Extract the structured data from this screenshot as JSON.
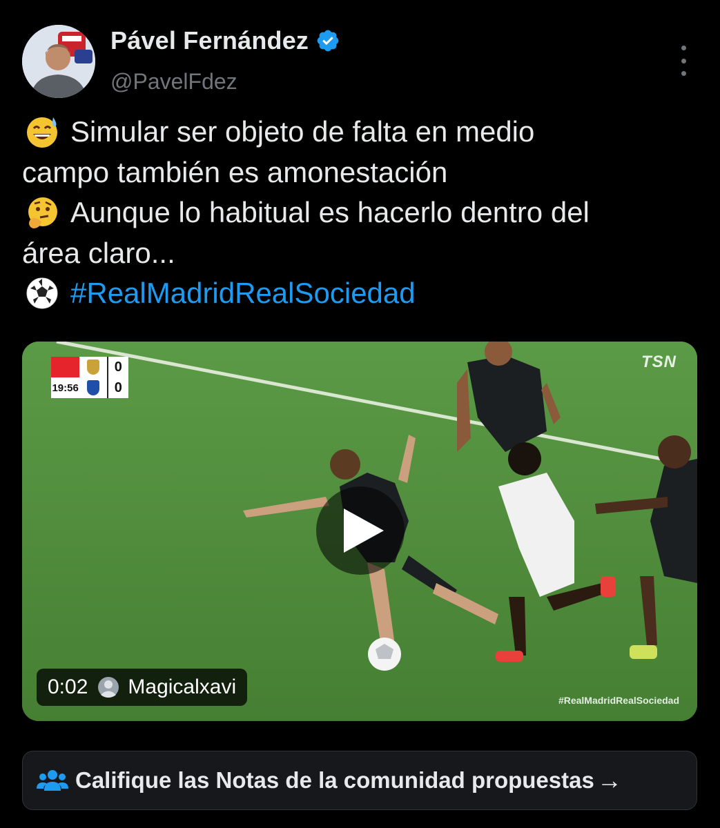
{
  "author": {
    "name": "Pável Fernández",
    "handle": "@PavelFdez",
    "verified": true,
    "avatar_icon": "avatar-photo"
  },
  "tweet": {
    "lines": [
      {
        "emoji": "grinning-sweat-emoji",
        "text": "Simular ser objeto de falta en medio"
      },
      {
        "emoji": "",
        "text": "campo también es amonestación"
      },
      {
        "emoji": "thinking-face-emoji",
        "text": "Aunque lo habitual es hacerlo dentro del"
      },
      {
        "emoji": "",
        "text": "área claro..."
      },
      {
        "emoji": "soccer-ball-emoji",
        "text": "#RealMadridRealSociedad"
      }
    ],
    "hashtag_color": "#1d9bf0"
  },
  "video": {
    "scoreboard": {
      "clock": "19:56",
      "home_score": "0",
      "away_score": "0"
    },
    "broadcaster": "TSN",
    "watermark": "#RealMadridRealSociedad",
    "duration": "0:02",
    "uploader": "Magicalxavi"
  },
  "community_notes": {
    "label": "Califique las Notas de la comunidad propuestas",
    "arrow": "→"
  },
  "colors": {
    "background": "#000000",
    "text_primary": "#e7e9ea",
    "text_secondary": "#71767b",
    "accent": "#1d9bf0"
  }
}
